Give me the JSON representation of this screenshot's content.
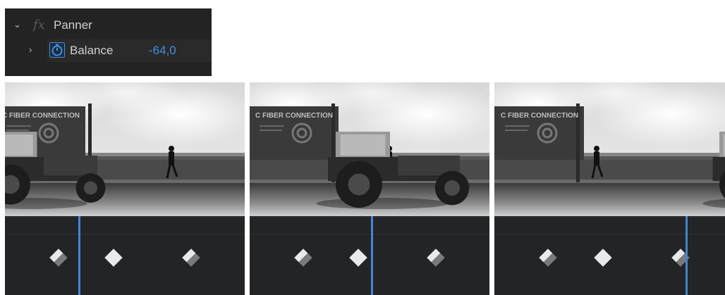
{
  "effect_panel": {
    "effect": {
      "fx_label": "fx",
      "name": "Panner",
      "expanded": true
    },
    "parameter": {
      "name": "Balance",
      "value": "-64,0",
      "expanded": false,
      "value_color": "#3f8fe3"
    },
    "icons": {
      "collapse": "chevron-down-icon",
      "expand": "chevron-right-icon",
      "stopwatch": "stopwatch-icon"
    }
  },
  "frames": [
    {
      "billboard_text": "C FIBER CONNECTION",
      "keyframes": [
        "half",
        "white",
        "half"
      ],
      "playhead_fraction": 0.31
    },
    {
      "billboard_text": "C FIBER CONNECTION",
      "keyframes": [
        "half",
        "white",
        "half"
      ],
      "playhead_fraction": 0.51
    },
    {
      "billboard_text": "C FIBER CONNECTION",
      "keyframes": [
        "half",
        "white",
        "half"
      ],
      "playhead_fraction": 0.8
    }
  ],
  "colors": {
    "panel_bg": "#232323",
    "timeline_bg": "#232426",
    "playhead": "#3f86d8",
    "keyframe": "#e9e9e9"
  }
}
